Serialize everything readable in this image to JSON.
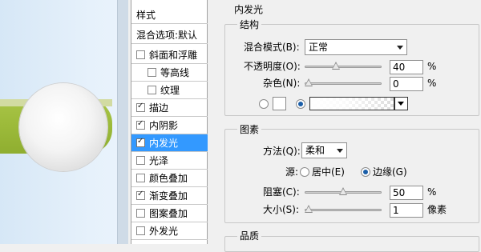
{
  "styles_list": {
    "items": [
      {
        "label": "样式",
        "checkbox": false,
        "checked": false,
        "selected": false,
        "indent": false
      },
      {
        "label": "混合选项:默认",
        "checkbox": false,
        "checked": false,
        "selected": false,
        "indent": false
      },
      {
        "label": "斜面和浮雕",
        "checkbox": true,
        "checked": false,
        "selected": false,
        "indent": false
      },
      {
        "label": "等高线",
        "checkbox": true,
        "checked": false,
        "selected": false,
        "indent": true
      },
      {
        "label": "纹理",
        "checkbox": true,
        "checked": false,
        "selected": false,
        "indent": true
      },
      {
        "label": "描边",
        "checkbox": true,
        "checked": true,
        "selected": false,
        "indent": false
      },
      {
        "label": "内阴影",
        "checkbox": true,
        "checked": true,
        "selected": false,
        "indent": false
      },
      {
        "label": "内发光",
        "checkbox": true,
        "checked": true,
        "selected": true,
        "indent": false
      },
      {
        "label": "光泽",
        "checkbox": true,
        "checked": false,
        "selected": false,
        "indent": false
      },
      {
        "label": "颜色叠加",
        "checkbox": true,
        "checked": false,
        "selected": false,
        "indent": false
      },
      {
        "label": "渐变叠加",
        "checkbox": true,
        "checked": true,
        "selected": false,
        "indent": false
      },
      {
        "label": "图案叠加",
        "checkbox": true,
        "checked": false,
        "selected": false,
        "indent": false
      },
      {
        "label": "外发光",
        "checkbox": true,
        "checked": false,
        "selected": false,
        "indent": false
      }
    ]
  },
  "inner_glow": {
    "title": "内发光",
    "structure": {
      "title": "结构",
      "blend_mode_label": "混合模式(B):",
      "blend_mode_value": "正常",
      "opacity_label": "不透明度(O):",
      "opacity_value": "40",
      "opacity_unit": "%",
      "opacity_level": 0.4,
      "noise_label": "杂色(N):",
      "noise_value": "0",
      "noise_unit": "%",
      "noise_level": 0,
      "color_swatch": "#ffffff",
      "color_mode": "gradient"
    },
    "elements": {
      "title": "图素",
      "technique_label": "方法(Q):",
      "technique_value": "柔和",
      "source_label": "源:",
      "source_center_label": "居中(E)",
      "source_edge_label": "边缘(G)",
      "source_selected": "edge",
      "choke_label": "阻塞(C):",
      "choke_value": "50",
      "choke_unit": "%",
      "choke_level": 0.5,
      "size_label": "大小(S):",
      "size_value": "1",
      "size_unit": "像素",
      "size_level": 0.005
    },
    "quality": {
      "title": "品质"
    }
  },
  "colors": {
    "selection": "#3399ff",
    "preview_bar": "#9dbb3b",
    "preview_bg": "#dfeefb"
  }
}
